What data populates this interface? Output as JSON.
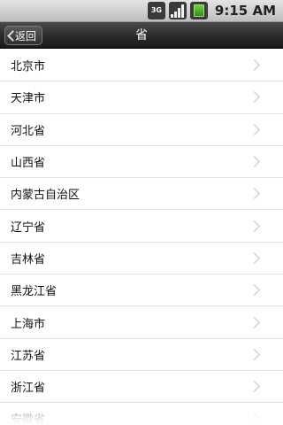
{
  "status_bar": {
    "network_label": "3G",
    "time": "9:15 AM",
    "icons": [
      "3g-icon",
      "signal-icon",
      "battery-icon"
    ]
  },
  "title_bar": {
    "back_label": "返回",
    "title": "省"
  },
  "provinces": [
    "北京市",
    "天津市",
    "河北省",
    "山西省",
    "内蒙古自治区",
    "辽宁省",
    "吉林省",
    "黑龙江省",
    "上海市",
    "江苏省",
    "浙江省",
    "安徽省"
  ]
}
